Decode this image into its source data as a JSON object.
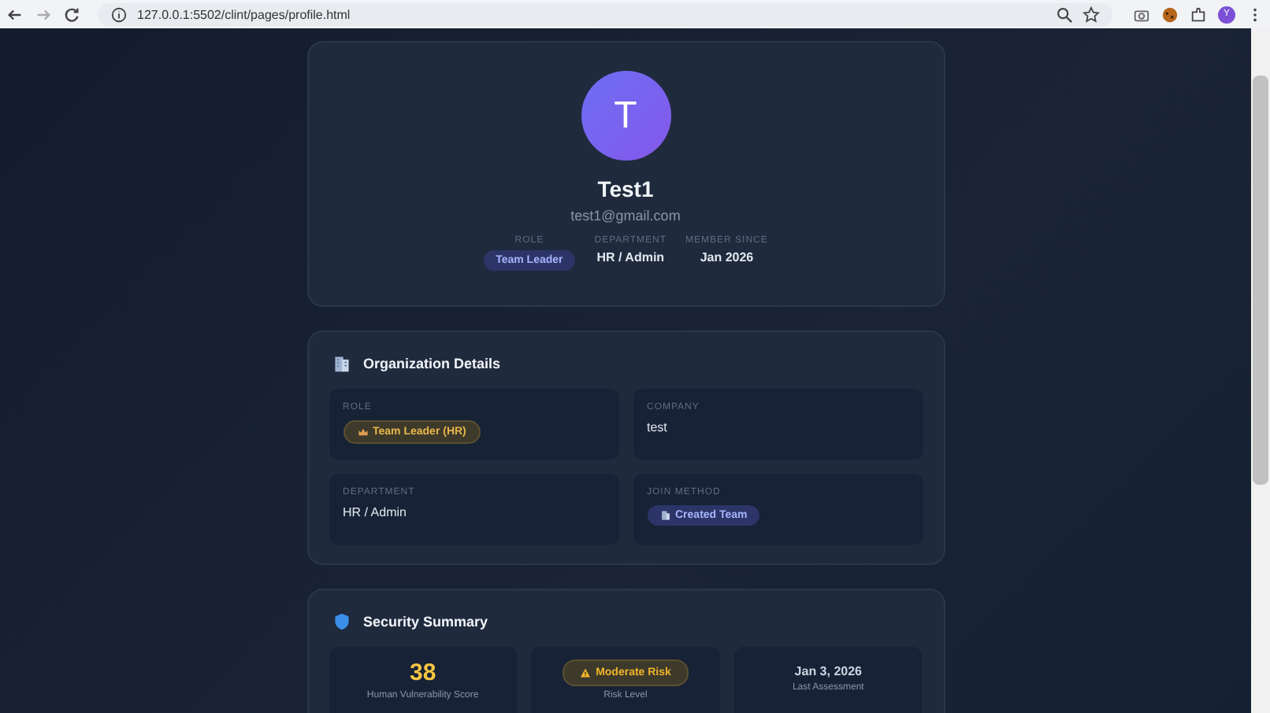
{
  "browser": {
    "url": "127.0.0.1:5502/clint/pages/profile.html",
    "profile_initial": "Y"
  },
  "profile": {
    "avatar_initial": "T",
    "name": "Test1",
    "email": "test1@gmail.com",
    "meta": [
      {
        "label": "ROLE",
        "value": "Team Leader",
        "kind": "badge"
      },
      {
        "label": "DEPARTMENT",
        "value": "HR / Admin",
        "kind": "text"
      },
      {
        "label": "MEMBER SINCE",
        "value": "Jan 2026",
        "kind": "text"
      }
    ]
  },
  "organization": {
    "title": "Organization Details",
    "fields": [
      {
        "label": "ROLE",
        "value": "Team Leader (HR)",
        "kind": "role-badge"
      },
      {
        "label": "COMPANY",
        "value": "test",
        "kind": "text"
      },
      {
        "label": "DEPARTMENT",
        "value": "HR / Admin",
        "kind": "text"
      },
      {
        "label": "JOIN METHOD",
        "value": "Created Team",
        "kind": "team-badge"
      }
    ]
  },
  "security": {
    "title": "Security Summary",
    "stats": [
      {
        "kind": "score",
        "value": "38",
        "label": "Human Vulnerability Score"
      },
      {
        "kind": "risk",
        "value": "Moderate Risk",
        "label": "Risk Level"
      },
      {
        "kind": "date",
        "value": "Jan 3, 2026",
        "label": "Last Assessment"
      }
    ]
  }
}
